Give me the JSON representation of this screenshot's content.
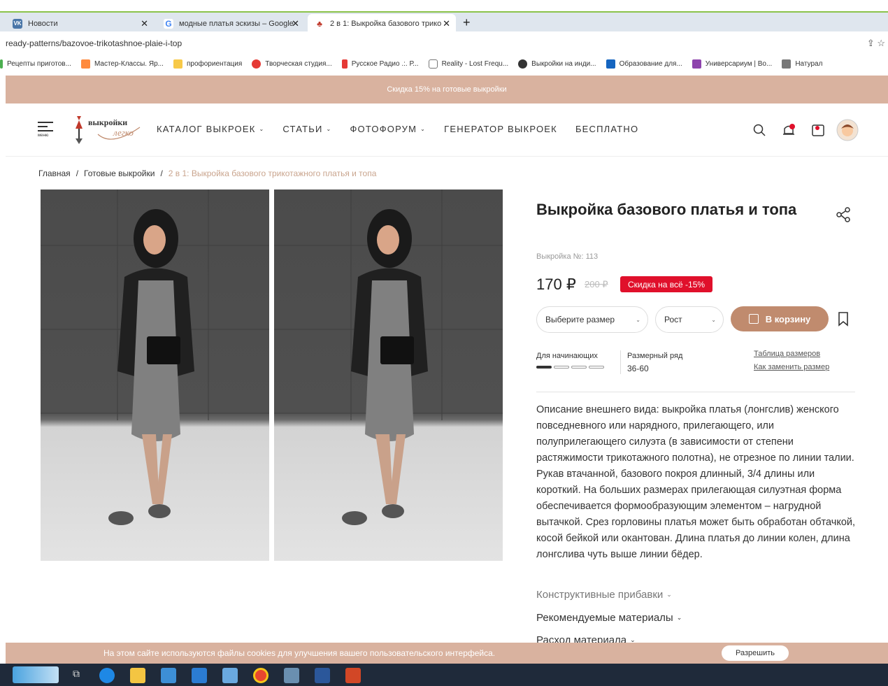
{
  "browser": {
    "tabs": [
      {
        "title": "Новости",
        "favicon": "vk-icon",
        "color": "#4a76a8"
      },
      {
        "title": "модные платья эскизы – Google",
        "favicon": "google-icon",
        "color": "#ffffff"
      },
      {
        "title": "2 в 1: Выкройка базового трико",
        "favicon": "vykroyka-icon",
        "color": "#c0392b"
      }
    ],
    "url": "ready-patterns/bazovoe-trikotashnoe-plaie-i-top",
    "bookmarks": [
      {
        "label": "Рецепты приготов...",
        "color": "#4caf50"
      },
      {
        "label": "Мастер-Классы. Яр...",
        "color": "#ff8a3d"
      },
      {
        "label": "профориентация",
        "color": "#f7c948"
      },
      {
        "label": "Творческая студия...",
        "color": "#e53935"
      },
      {
        "label": "Русское Радио .:. Р...",
        "color": "#e53935"
      },
      {
        "label": "Reality - Lost Frequ...",
        "color": "#777777"
      },
      {
        "label": "Выкройки на инди...",
        "color": "#333333"
      },
      {
        "label": "Образование для...",
        "color": "#1565c0"
      },
      {
        "label": "Универсариум | Во...",
        "color": "#8e44ad"
      },
      {
        "label": "Натурал",
        "color": "#777777"
      }
    ]
  },
  "site": {
    "promo": "Скидка 15% на готовые выкройки",
    "menu_label": "меню",
    "logo_text_top": "выкройки",
    "logo_text_bottom": "легко",
    "nav": [
      {
        "label": "КАТАЛОГ ВЫКРОЕК",
        "dropdown": true
      },
      {
        "label": "СТАТЬИ",
        "dropdown": true
      },
      {
        "label": "ФОТОФОРУМ",
        "dropdown": true
      },
      {
        "label": "ГЕНЕРАТОР ВЫКРОЕК",
        "dropdown": false
      },
      {
        "label": "БЕСПЛАТНО",
        "dropdown": false
      }
    ],
    "accent": "#c08b6e",
    "promo_color": "#d9b29f"
  },
  "breadcrumb": [
    "Главная",
    "Готовые выкройки",
    "2 в 1: Выкройка базового трикотажного платья и топа"
  ],
  "product": {
    "title": "Выкройка базового платья и топа",
    "sku": "Выкройка №: 113",
    "price": "170 ₽",
    "old_price": "200 ₽",
    "discount": "Скидка на всё -15%",
    "size_placeholder": "Выберите размер",
    "height_placeholder": "Рост",
    "cart_label": "В корзину",
    "level_label": "Для начинающих",
    "level": 1,
    "level_max": 4,
    "size_range_label": "Размерный ряд",
    "size_range_value": "36-60",
    "size_table_link": "Таблица размеров",
    "size_replace_link": "Как заменить размер",
    "description": "Описание внешнего вида: выкройка платья (лонгслив) женского повседневного или нарядного, прилегающего, или полуприлегающего силуэта (в зависимости от степени растяжимости трикотажного полотна), не отрезное по линии талии. Рукав втачанной, базового покроя длинный, 3/4 длины или короткий. На больших размерах прилегающая силуэтная форма обеспечивается формообразующим элементом – нагрудной вытачкой. Срез горловины платья может быть обработан обтачкой, косой бейкой или окантован. Длина платья до линии колен, длина лонгслива чуть выше линии бёдер.",
    "accordions": [
      "Конструктивные прибавки",
      "Рекомендуемые материалы",
      "Расход материала"
    ]
  },
  "cookie": {
    "text": "На этом сайте используются файлы cookies для улучшения вашего пользовательского интерфейса.",
    "allow": "Разрешить"
  }
}
